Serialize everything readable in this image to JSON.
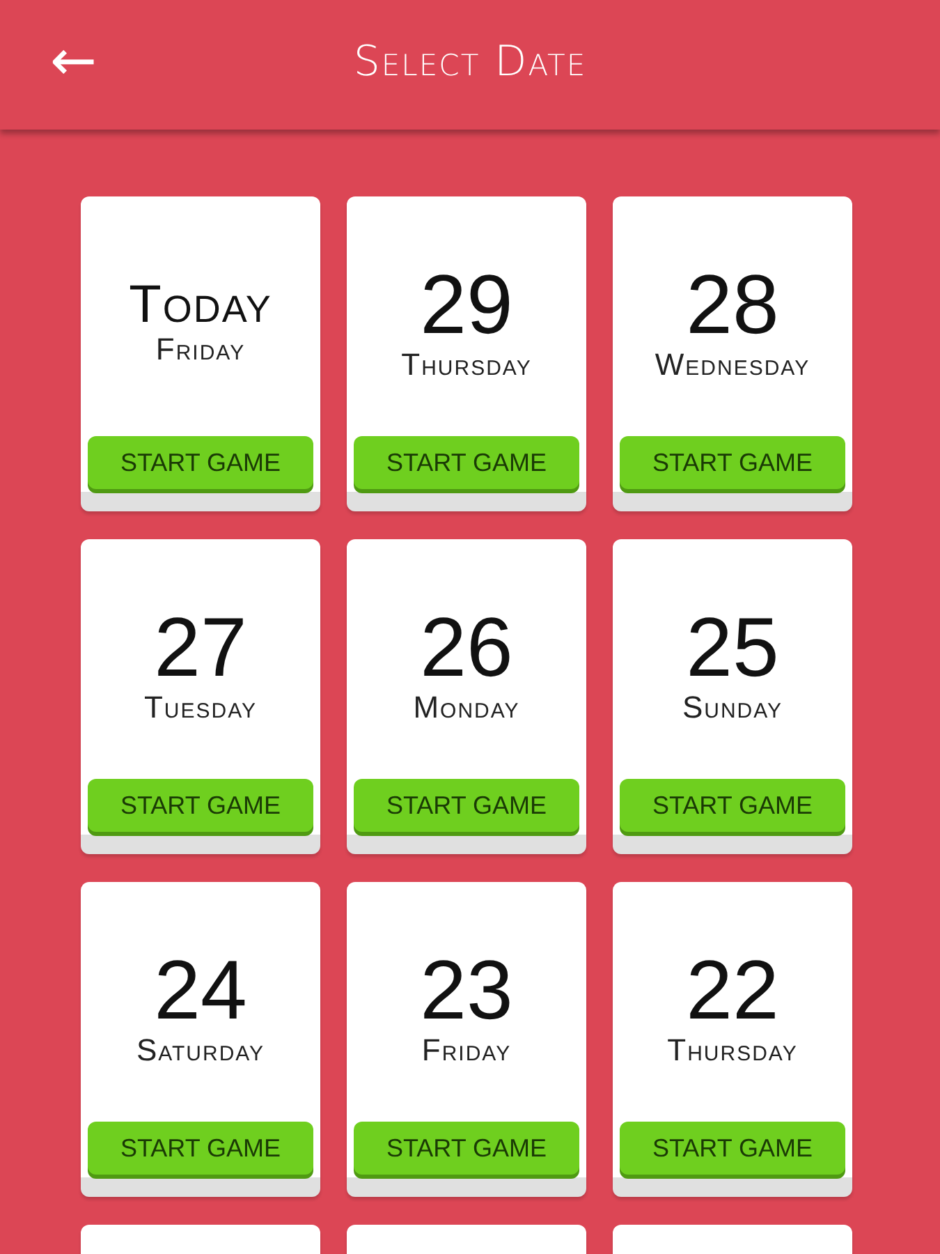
{
  "header": {
    "back": "←",
    "title": "Select Date"
  },
  "cards": [
    {
      "kind": "today",
      "big": "Today",
      "day": "Friday",
      "button": "START GAME"
    },
    {
      "kind": "date",
      "big": "29",
      "day": "Thursday",
      "button": "START GAME"
    },
    {
      "kind": "date",
      "big": "28",
      "day": "Wednesday",
      "button": "START GAME"
    },
    {
      "kind": "date",
      "big": "27",
      "day": "Tuesday",
      "button": "START GAME"
    },
    {
      "kind": "date",
      "big": "26",
      "day": "Monday",
      "button": "START GAME"
    },
    {
      "kind": "date",
      "big": "25",
      "day": "Sunday",
      "button": "START GAME"
    },
    {
      "kind": "date",
      "big": "24",
      "day": "Saturday",
      "button": "START GAME"
    },
    {
      "kind": "date",
      "big": "23",
      "day": "Friday",
      "button": "START GAME"
    },
    {
      "kind": "date",
      "big": "22",
      "day": "Thursday",
      "button": "START GAME"
    },
    {
      "kind": "cutoff"
    },
    {
      "kind": "cutoff"
    },
    {
      "kind": "cutoff"
    }
  ]
}
